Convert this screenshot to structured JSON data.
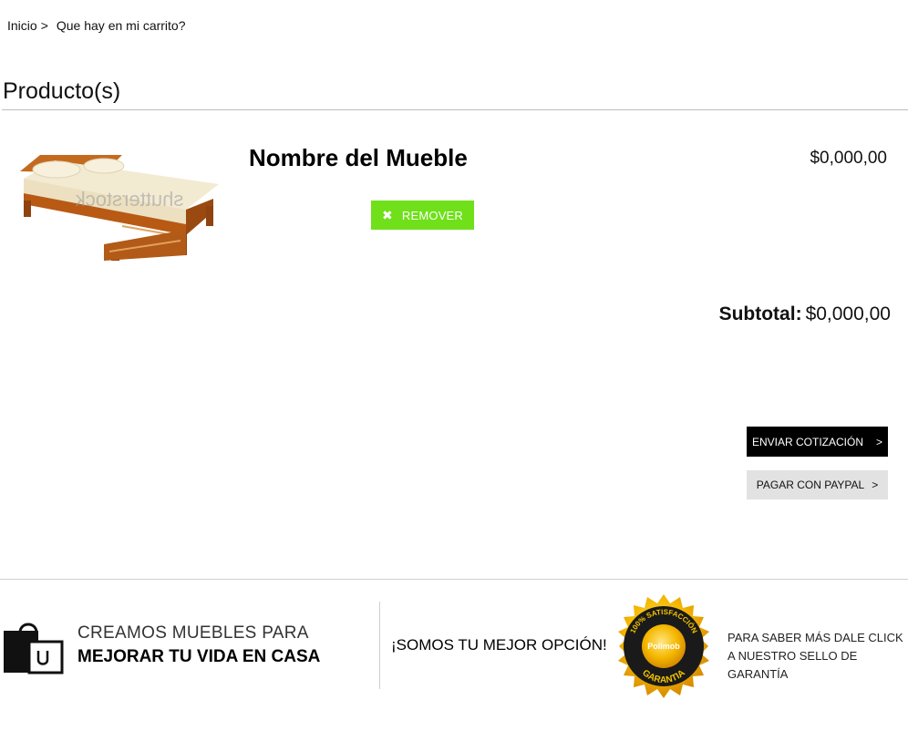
{
  "breadcrumb": {
    "home": "Inicio",
    "separator": ">",
    "current": "Que hay en mi carrito?"
  },
  "cart": {
    "section_title": "Producto(s)",
    "items": [
      {
        "name": "Nombre del Mueble",
        "price": "$0,000,00",
        "remove_label": "REMOVER",
        "image_watermark": "shutterstock"
      }
    ],
    "subtotal_label": "Subtotal:",
    "subtotal_value": "$0,000,00"
  },
  "actions": {
    "quote_label": "ENVIAR COTIZACIÓN",
    "paypal_label": "PAGAR CON PAYPAL",
    "arrow": ">"
  },
  "footer": {
    "tagline_top": "CREAMOS MUEBLES PARA",
    "tagline_bottom": "MEJORAR TU VIDA EN CASA",
    "best_option": "¡SOMOS TU MEJOR OPCIÓN!",
    "seal": {
      "ring_text": "100% SATISFACCIÓN",
      "brand": "Polimob",
      "bottom_text": "GARANTIA"
    },
    "seal_info_line1": "PARA SABER MÁS DALE CLICK",
    "seal_info_line2": "A NUESTRO SELLO DE GARANTÍA"
  },
  "colors": {
    "remove_button": "#6fe01a",
    "quote_button": "#000000",
    "paypal_button": "#e2e2e2",
    "seal_gold": "#f5b800"
  }
}
